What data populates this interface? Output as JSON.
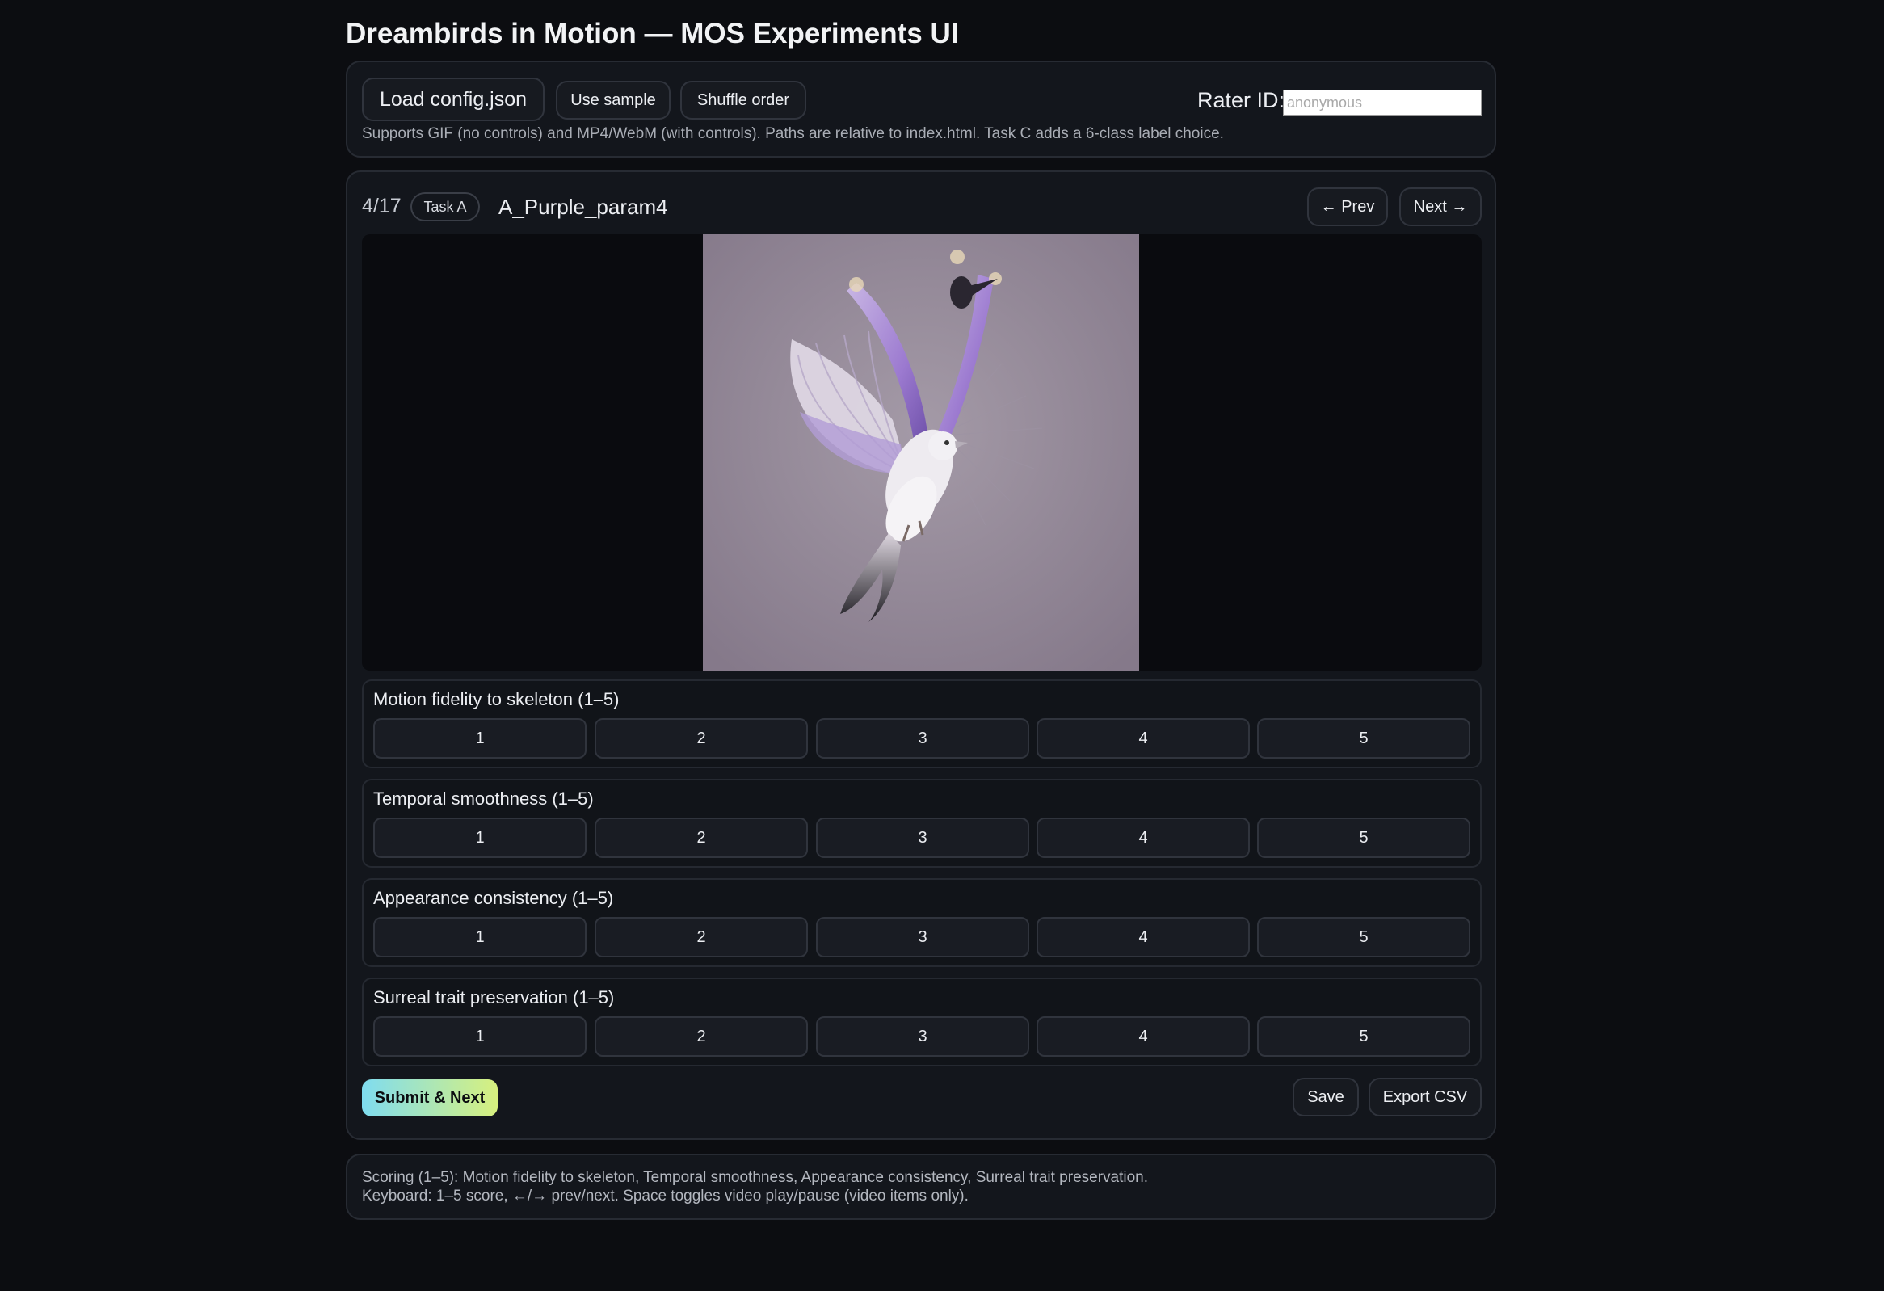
{
  "page_title": "Dreambirds in Motion — MOS Experiments UI",
  "toolbar": {
    "load_config_label": "Load config.json",
    "use_sample_label": "Use sample",
    "shuffle_label": "Shuffle order",
    "rater_label": "Rater ID:",
    "rater_placeholder": "anonymous",
    "rater_value": "",
    "hint": "Supports GIF (no controls) and MP4/WebM (with controls). Paths are relative to index.html. Task C adds a 6-class label choice."
  },
  "item": {
    "counter": "4/17",
    "task_badge": "Task A",
    "id": "A_Purple_param4",
    "prev_label": "← Prev",
    "next_label": "Next →"
  },
  "criteria": [
    {
      "label": "Motion fidelity to skeleton (1–5)",
      "scores": [
        "1",
        "2",
        "3",
        "4",
        "5"
      ]
    },
    {
      "label": "Temporal smoothness (1–5)",
      "scores": [
        "1",
        "2",
        "3",
        "4",
        "5"
      ]
    },
    {
      "label": "Appearance consistency (1–5)",
      "scores": [
        "1",
        "2",
        "3",
        "4",
        "5"
      ]
    },
    {
      "label": "Surreal trait preservation (1–5)",
      "scores": [
        "1",
        "2",
        "3",
        "4",
        "5"
      ]
    }
  ],
  "actions": {
    "submit_label": "Submit & Next",
    "save_label": "Save",
    "export_label": "Export CSV"
  },
  "footer": {
    "line1": "Scoring (1–5): Motion fidelity to skeleton, Temporal smoothness, Appearance consistency, Surreal trait preservation.",
    "line2": "Keyboard: 1–5 score, ←/→ prev/next. Space toggles video play/pause (video items only)."
  },
  "colors": {
    "background": "#0c0d11",
    "card": "#13161c",
    "submit_gradient_start": "#7fdcf0",
    "submit_gradient_end": "#d7f07e"
  }
}
